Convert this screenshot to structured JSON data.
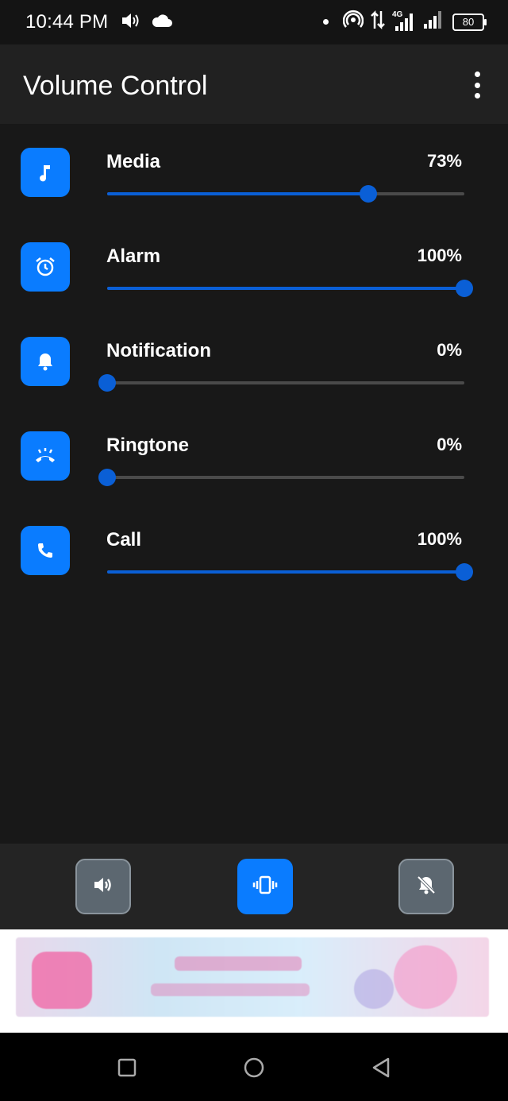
{
  "status_bar": {
    "time": "10:44 PM",
    "network_label": "4G",
    "battery": "80",
    "icons": [
      "volume-icon",
      "cloud-icon",
      "notification-dot-icon",
      "hotspot-icon",
      "data-transfer-icon",
      "signal-4g-icon",
      "signal-icon",
      "battery-icon"
    ]
  },
  "app_bar": {
    "title": "Volume Control",
    "menu_icon": "more-vert-icon"
  },
  "streams": [
    {
      "label": "Media",
      "value_text": "73%",
      "level": 73,
      "icon": "music-note-icon"
    },
    {
      "label": "Alarm",
      "value_text": "100%",
      "level": 100,
      "icon": "alarm-clock-icon"
    },
    {
      "label": "Notification",
      "value_text": "0%",
      "level": 0,
      "icon": "bell-icon"
    },
    {
      "label": "Ringtone",
      "value_text": "0%",
      "level": 0,
      "icon": "ringing-phone-icon"
    },
    {
      "label": "Call",
      "value_text": "100%",
      "level": 100,
      "icon": "phone-icon"
    }
  ],
  "modes": [
    {
      "name": "sound",
      "icon": "speaker-icon",
      "active": false
    },
    {
      "name": "vibrate",
      "icon": "vibrate-icon",
      "active": true
    },
    {
      "name": "silent",
      "icon": "bell-off-icon",
      "active": false
    }
  ],
  "colors": {
    "accent": "#0a7cff",
    "slider": "#0a5fd6",
    "background": "#181818",
    "app_bar": "#212121",
    "mode_bar": "#242424",
    "inactive_button": "#5c6770"
  },
  "nav_bar": {
    "buttons": [
      "recents-square-icon",
      "home-circle-icon",
      "back-triangle-icon"
    ]
  }
}
